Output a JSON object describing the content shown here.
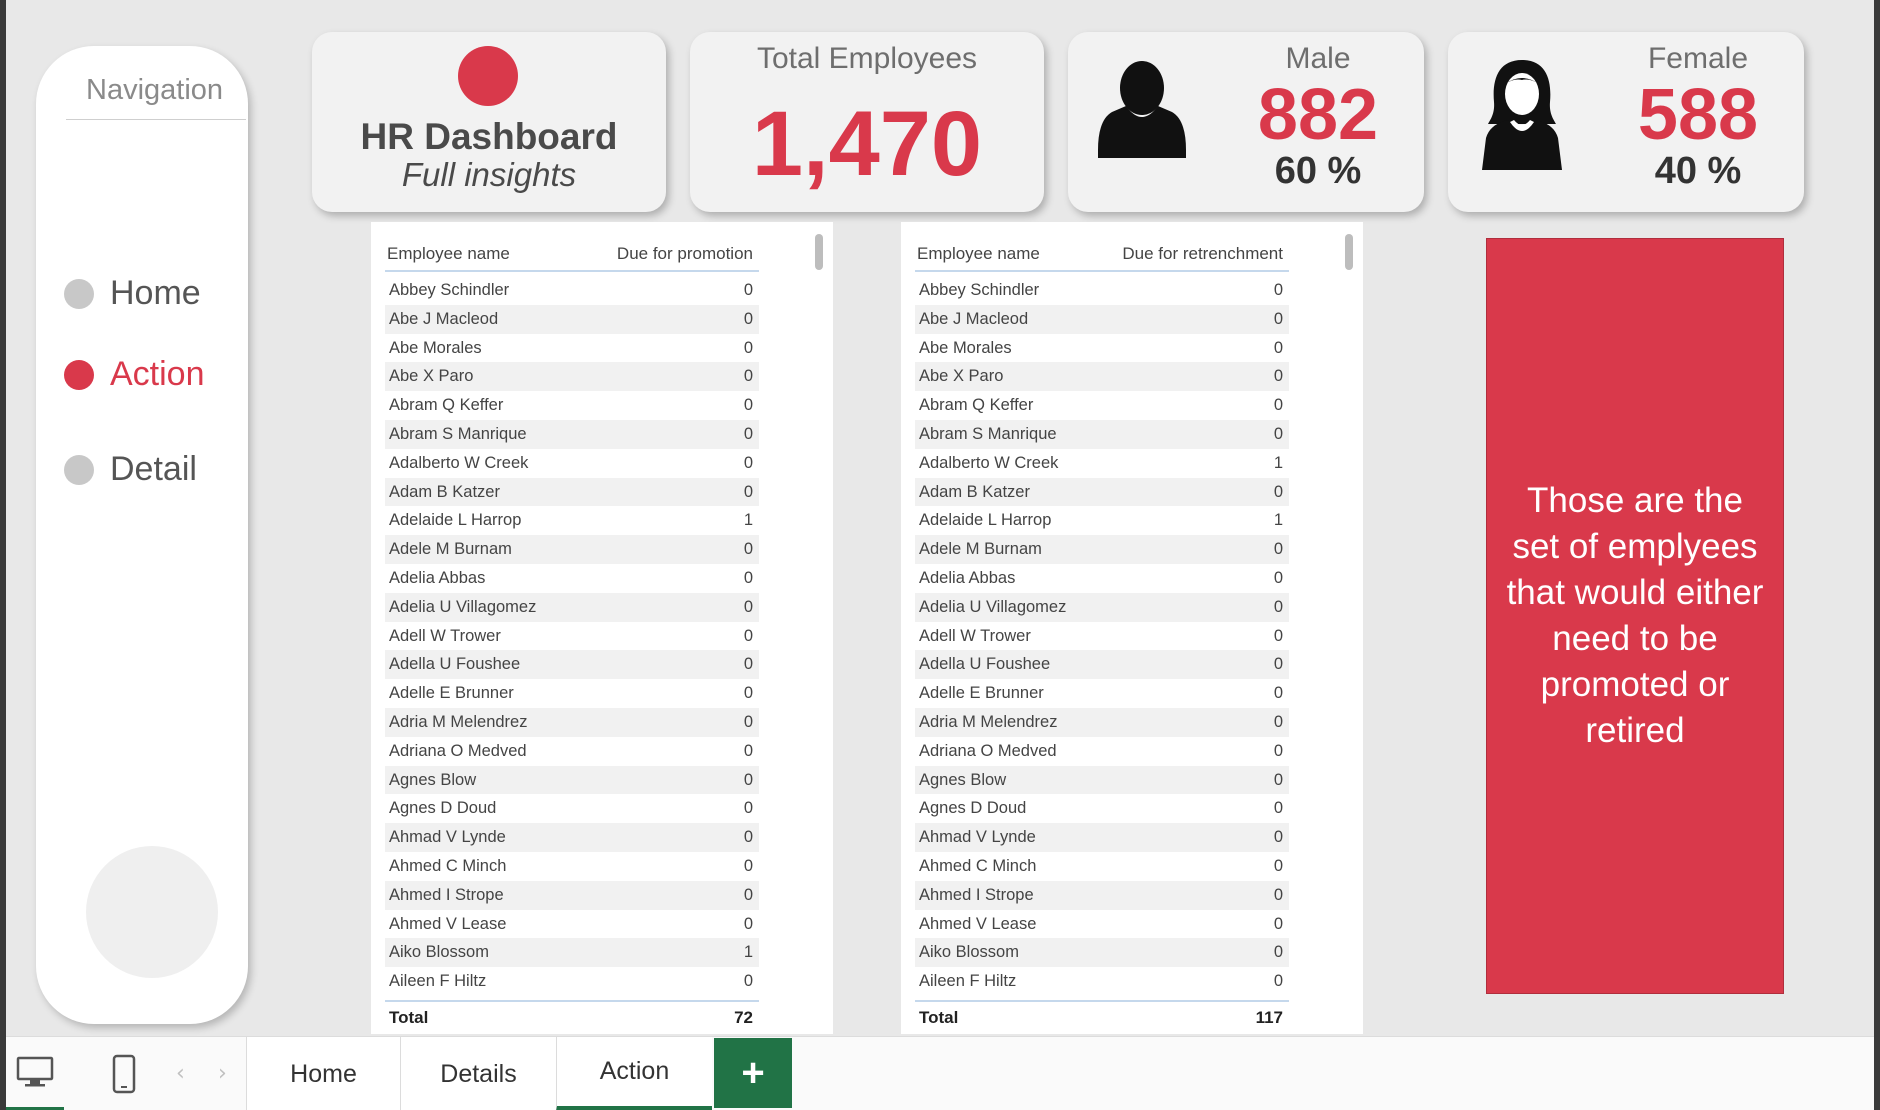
{
  "nav": {
    "title": "Navigation",
    "items": [
      {
        "label": "Home",
        "active": false
      },
      {
        "label": "Action",
        "active": true
      },
      {
        "label": "Detail",
        "active": false
      }
    ]
  },
  "kpi": {
    "hr_title": "HR Dashboard",
    "hr_subtitle": "Full insights",
    "total_label": "Total Employees",
    "total_value": "1,470",
    "male_label": "Male",
    "male_value": "882",
    "male_pct": "60 %",
    "female_label": "Female",
    "female_value": "588",
    "female_pct": "40 %"
  },
  "colors": {
    "accent": "#d9394b",
    "tab_accent": "#217346"
  },
  "promotion_table": {
    "col_name": "Employee name",
    "col_value": "Due for promotion",
    "total_label": "Total",
    "total_value": "72",
    "rows": [
      {
        "name": "Abbey Schindler",
        "value": "0"
      },
      {
        "name": "Abe J Macleod",
        "value": "0"
      },
      {
        "name": "Abe Morales",
        "value": "0"
      },
      {
        "name": "Abe X Paro",
        "value": "0"
      },
      {
        "name": "Abram Q Keffer",
        "value": "0"
      },
      {
        "name": "Abram S Manrique",
        "value": "0"
      },
      {
        "name": "Adalberto W Creek",
        "value": "0"
      },
      {
        "name": "Adam B Katzer",
        "value": "0"
      },
      {
        "name": "Adelaide L Harrop",
        "value": "1"
      },
      {
        "name": "Adele M Burnam",
        "value": "0"
      },
      {
        "name": "Adelia Abbas",
        "value": "0"
      },
      {
        "name": "Adelia U Villagomez",
        "value": "0"
      },
      {
        "name": "Adell W Trower",
        "value": "0"
      },
      {
        "name": "Adella U Foushee",
        "value": "0"
      },
      {
        "name": "Adelle E Brunner",
        "value": "0"
      },
      {
        "name": "Adria M Melendrez",
        "value": "0"
      },
      {
        "name": "Adriana O Medved",
        "value": "0"
      },
      {
        "name": "Agnes Blow",
        "value": "0"
      },
      {
        "name": "Agnes D Doud",
        "value": "0"
      },
      {
        "name": "Ahmad V Lynde",
        "value": "0"
      },
      {
        "name": "Ahmed C Minch",
        "value": "0"
      },
      {
        "name": "Ahmed I Strope",
        "value": "0"
      },
      {
        "name": "Ahmed V Lease",
        "value": "0"
      },
      {
        "name": "Aiko Blossom",
        "value": "1"
      },
      {
        "name": "Aileen F Hiltz",
        "value": "0"
      }
    ]
  },
  "retrenchment_table": {
    "col_name": "Employee name",
    "col_value": "Due for retrenchment",
    "total_label": "Total",
    "total_value": "117",
    "rows": [
      {
        "name": "Abbey Schindler",
        "value": "0"
      },
      {
        "name": "Abe J Macleod",
        "value": "0"
      },
      {
        "name": "Abe Morales",
        "value": "0"
      },
      {
        "name": "Abe X Paro",
        "value": "0"
      },
      {
        "name": "Abram Q Keffer",
        "value": "0"
      },
      {
        "name": "Abram S Manrique",
        "value": "0"
      },
      {
        "name": "Adalberto W Creek",
        "value": "1"
      },
      {
        "name": "Adam B Katzer",
        "value": "0"
      },
      {
        "name": "Adelaide L Harrop",
        "value": "1"
      },
      {
        "name": "Adele M Burnam",
        "value": "0"
      },
      {
        "name": "Adelia Abbas",
        "value": "0"
      },
      {
        "name": "Adelia U Villagomez",
        "value": "0"
      },
      {
        "name": "Adell W Trower",
        "value": "0"
      },
      {
        "name": "Adella U Foushee",
        "value": "0"
      },
      {
        "name": "Adelle E Brunner",
        "value": "0"
      },
      {
        "name": "Adria M Melendrez",
        "value": "0"
      },
      {
        "name": "Adriana O Medved",
        "value": "0"
      },
      {
        "name": "Agnes Blow",
        "value": "0"
      },
      {
        "name": "Agnes D Doud",
        "value": "0"
      },
      {
        "name": "Ahmad V Lynde",
        "value": "0"
      },
      {
        "name": "Ahmed C Minch",
        "value": "0"
      },
      {
        "name": "Ahmed I Strope",
        "value": "0"
      },
      {
        "name": "Ahmed V Lease",
        "value": "0"
      },
      {
        "name": "Aiko Blossom",
        "value": "0"
      },
      {
        "name": "Aileen F Hiltz",
        "value": "0"
      }
    ]
  },
  "info_box": {
    "text": "Those are the set of emplyees that would either need to be promoted or retired"
  },
  "tabbar": {
    "icons": [
      "desktop-icon",
      "phone-icon",
      "prev-page-icon",
      "next-page-icon"
    ],
    "tabs": [
      "Home",
      "Details",
      "Action"
    ],
    "active_tab": "Action",
    "add_label": "+"
  }
}
